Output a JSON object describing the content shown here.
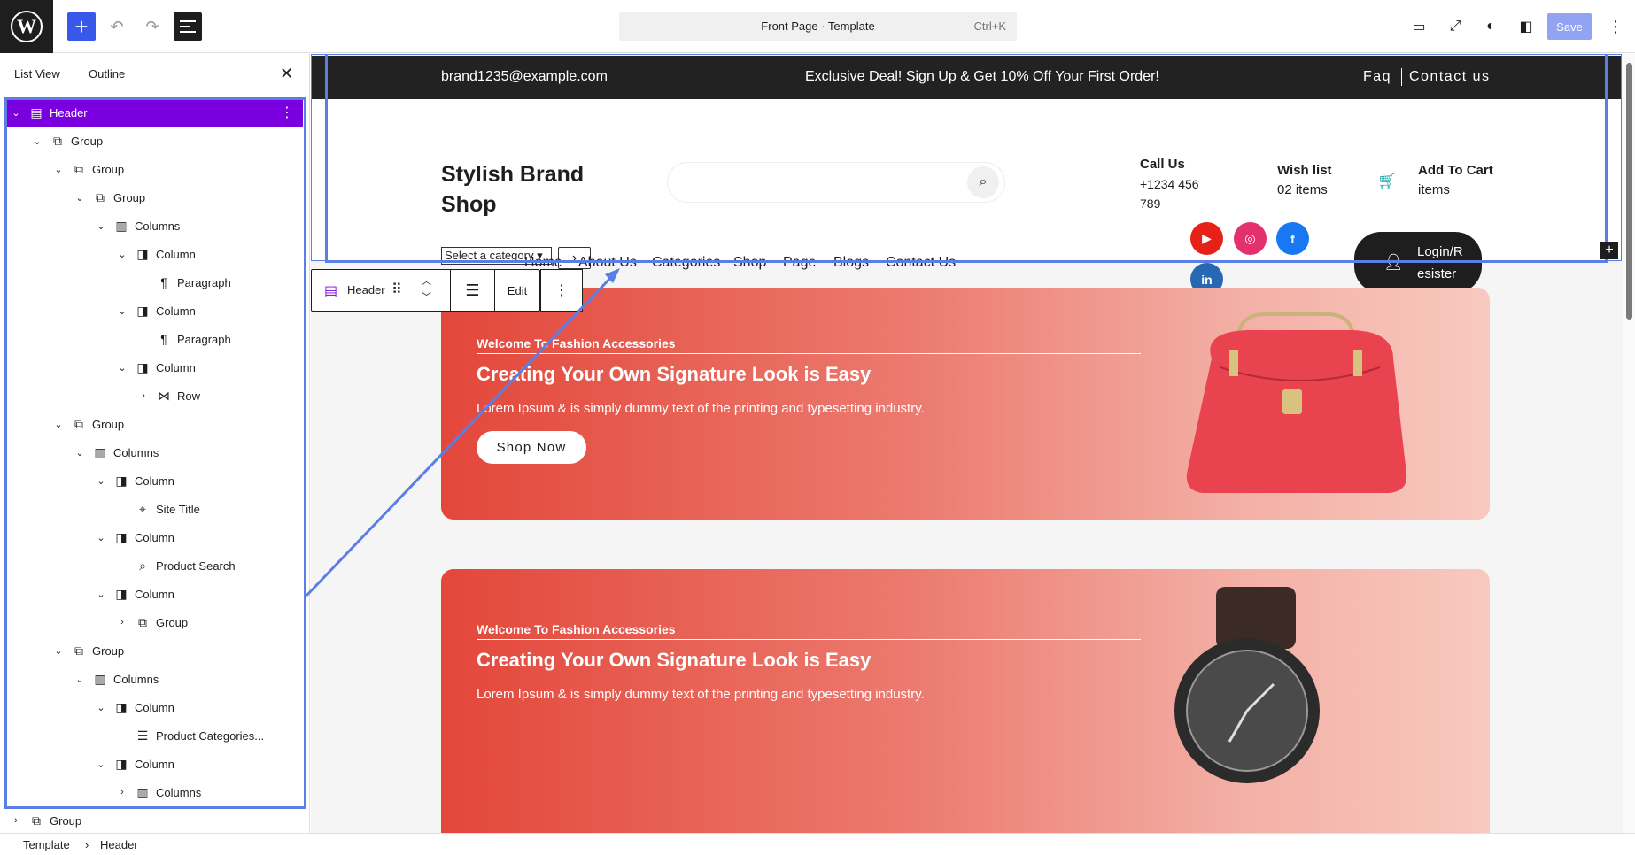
{
  "topbar": {
    "add_label": "+",
    "command_center": "Front Page · Template",
    "shortcut": "Ctrl+K",
    "save_label": "Save"
  },
  "sidebar": {
    "tabs": [
      "List View",
      "Outline"
    ],
    "tree": [
      {
        "label": "Header",
        "depth": 0,
        "icon": "template-part-icon",
        "sel": true,
        "chev": "down"
      },
      {
        "label": "Group",
        "depth": 1,
        "icon": "group-icon",
        "chev": "down"
      },
      {
        "label": "Group",
        "depth": 2,
        "icon": "group-icon",
        "chev": "down"
      },
      {
        "label": "Group",
        "depth": 3,
        "icon": "group-icon",
        "chev": "down"
      },
      {
        "label": "Columns",
        "depth": 4,
        "icon": "columns-icon",
        "chev": "down"
      },
      {
        "label": "Column",
        "depth": 5,
        "icon": "column-icon",
        "chev": "down"
      },
      {
        "label": "Paragraph",
        "depth": 6,
        "icon": "paragraph-icon"
      },
      {
        "label": "Column",
        "depth": 5,
        "icon": "column-icon",
        "chev": "down"
      },
      {
        "label": "Paragraph",
        "depth": 6,
        "icon": "paragraph-icon"
      },
      {
        "label": "Column",
        "depth": 5,
        "icon": "column-icon",
        "chev": "down"
      },
      {
        "label": "Row",
        "depth": 6,
        "icon": "row-icon",
        "chev": "right"
      },
      {
        "label": "Group",
        "depth": 2,
        "icon": "group-icon",
        "chev": "down"
      },
      {
        "label": "Columns",
        "depth": 3,
        "icon": "columns-icon",
        "chev": "down"
      },
      {
        "label": "Column",
        "depth": 4,
        "icon": "column-icon",
        "chev": "down"
      },
      {
        "label": "Site Title",
        "depth": 5,
        "icon": "map-marker-icon"
      },
      {
        "label": "Column",
        "depth": 4,
        "icon": "column-icon",
        "chev": "down"
      },
      {
        "label": "Product Search",
        "depth": 5,
        "icon": "search-icon"
      },
      {
        "label": "Column",
        "depth": 4,
        "icon": "column-icon",
        "chev": "down"
      },
      {
        "label": "Group",
        "depth": 5,
        "icon": "group-icon",
        "chev": "right"
      },
      {
        "label": "Group",
        "depth": 2,
        "icon": "group-icon",
        "chev": "down"
      },
      {
        "label": "Columns",
        "depth": 3,
        "icon": "columns-icon",
        "chev": "down"
      },
      {
        "label": "Column",
        "depth": 4,
        "icon": "column-icon",
        "chev": "down"
      },
      {
        "label": "Product Categories...",
        "depth": 5,
        "icon": "list-icon"
      },
      {
        "label": "Column",
        "depth": 4,
        "icon": "column-icon",
        "chev": "down"
      },
      {
        "label": "Columns",
        "depth": 5,
        "icon": "columns-icon",
        "chev": "right"
      },
      {
        "label": "Group",
        "depth": 0,
        "icon": "group-icon",
        "chev": "right"
      }
    ]
  },
  "site": {
    "email": "brand1235@example.com",
    "deal": "Exclusive Deal! Sign Up & Get 10% Off Your First Order!",
    "faq": "Faq",
    "contact": "Contact us",
    "title": "Stylish Brand Shop",
    "call_title": "Call Us",
    "call_number": "+1234 456 789",
    "wish_title": "Wish list",
    "wish_count": "02 items",
    "cart_title": "Add To Cart",
    "cart_sub": "items",
    "category_select": "Select a category",
    "nav": [
      "Home",
      "About Us",
      "Categories",
      "Shop",
      "Page",
      "Blogs",
      "Contact Us"
    ],
    "login": "Login/R esister"
  },
  "block_toolbar": {
    "label": "Header",
    "edit": "Edit"
  },
  "heroes": [
    {
      "kicker": "Welcome To Fashion Accessories",
      "heading": "Creating Your Own Signature Look is Easy",
      "text": "Lorem Ipsum & is simply dummy text of the printing and typesetting industry.",
      "button": "Shop Now"
    },
    {
      "kicker": "Welcome To Fashion Accessories",
      "heading": "Creating Your Own Signature Look is Easy",
      "text": "Lorem Ipsum & is simply dummy text of the printing and typesetting industry."
    }
  ],
  "breadcrumb": [
    "Template",
    "Header"
  ],
  "colors": {
    "accent": "#3858e9",
    "selection": "#7a00df",
    "outline": "#5b7ee5",
    "hero_start": "#e3473a"
  }
}
